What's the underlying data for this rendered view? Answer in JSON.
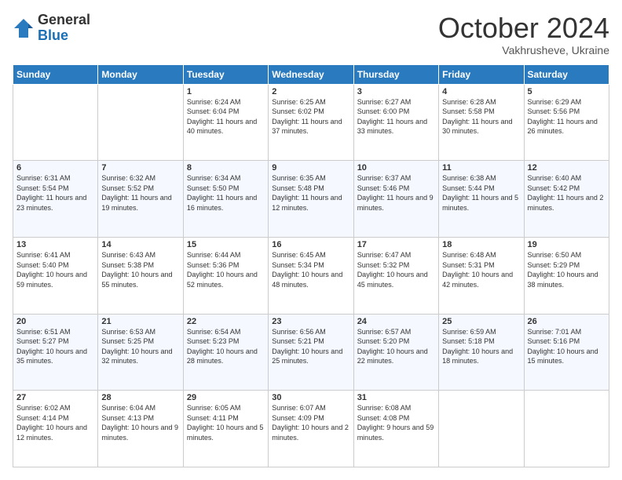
{
  "logo": {
    "general": "General",
    "blue": "Blue"
  },
  "header": {
    "month": "October 2024",
    "location": "Vakhrusheve, Ukraine"
  },
  "weekdays": [
    "Sunday",
    "Monday",
    "Tuesday",
    "Wednesday",
    "Thursday",
    "Friday",
    "Saturday"
  ],
  "weeks": [
    [
      {
        "day": "",
        "info": ""
      },
      {
        "day": "",
        "info": ""
      },
      {
        "day": "1",
        "info": "Sunrise: 6:24 AM\nSunset: 6:04 PM\nDaylight: 11 hours and 40 minutes."
      },
      {
        "day": "2",
        "info": "Sunrise: 6:25 AM\nSunset: 6:02 PM\nDaylight: 11 hours and 37 minutes."
      },
      {
        "day": "3",
        "info": "Sunrise: 6:27 AM\nSunset: 6:00 PM\nDaylight: 11 hours and 33 minutes."
      },
      {
        "day": "4",
        "info": "Sunrise: 6:28 AM\nSunset: 5:58 PM\nDaylight: 11 hours and 30 minutes."
      },
      {
        "day": "5",
        "info": "Sunrise: 6:29 AM\nSunset: 5:56 PM\nDaylight: 11 hours and 26 minutes."
      }
    ],
    [
      {
        "day": "6",
        "info": "Sunrise: 6:31 AM\nSunset: 5:54 PM\nDaylight: 11 hours and 23 minutes."
      },
      {
        "day": "7",
        "info": "Sunrise: 6:32 AM\nSunset: 5:52 PM\nDaylight: 11 hours and 19 minutes."
      },
      {
        "day": "8",
        "info": "Sunrise: 6:34 AM\nSunset: 5:50 PM\nDaylight: 11 hours and 16 minutes."
      },
      {
        "day": "9",
        "info": "Sunrise: 6:35 AM\nSunset: 5:48 PM\nDaylight: 11 hours and 12 minutes."
      },
      {
        "day": "10",
        "info": "Sunrise: 6:37 AM\nSunset: 5:46 PM\nDaylight: 11 hours and 9 minutes."
      },
      {
        "day": "11",
        "info": "Sunrise: 6:38 AM\nSunset: 5:44 PM\nDaylight: 11 hours and 5 minutes."
      },
      {
        "day": "12",
        "info": "Sunrise: 6:40 AM\nSunset: 5:42 PM\nDaylight: 11 hours and 2 minutes."
      }
    ],
    [
      {
        "day": "13",
        "info": "Sunrise: 6:41 AM\nSunset: 5:40 PM\nDaylight: 10 hours and 59 minutes."
      },
      {
        "day": "14",
        "info": "Sunrise: 6:43 AM\nSunset: 5:38 PM\nDaylight: 10 hours and 55 minutes."
      },
      {
        "day": "15",
        "info": "Sunrise: 6:44 AM\nSunset: 5:36 PM\nDaylight: 10 hours and 52 minutes."
      },
      {
        "day": "16",
        "info": "Sunrise: 6:45 AM\nSunset: 5:34 PM\nDaylight: 10 hours and 48 minutes."
      },
      {
        "day": "17",
        "info": "Sunrise: 6:47 AM\nSunset: 5:32 PM\nDaylight: 10 hours and 45 minutes."
      },
      {
        "day": "18",
        "info": "Sunrise: 6:48 AM\nSunset: 5:31 PM\nDaylight: 10 hours and 42 minutes."
      },
      {
        "day": "19",
        "info": "Sunrise: 6:50 AM\nSunset: 5:29 PM\nDaylight: 10 hours and 38 minutes."
      }
    ],
    [
      {
        "day": "20",
        "info": "Sunrise: 6:51 AM\nSunset: 5:27 PM\nDaylight: 10 hours and 35 minutes."
      },
      {
        "day": "21",
        "info": "Sunrise: 6:53 AM\nSunset: 5:25 PM\nDaylight: 10 hours and 32 minutes."
      },
      {
        "day": "22",
        "info": "Sunrise: 6:54 AM\nSunset: 5:23 PM\nDaylight: 10 hours and 28 minutes."
      },
      {
        "day": "23",
        "info": "Sunrise: 6:56 AM\nSunset: 5:21 PM\nDaylight: 10 hours and 25 minutes."
      },
      {
        "day": "24",
        "info": "Sunrise: 6:57 AM\nSunset: 5:20 PM\nDaylight: 10 hours and 22 minutes."
      },
      {
        "day": "25",
        "info": "Sunrise: 6:59 AM\nSunset: 5:18 PM\nDaylight: 10 hours and 18 minutes."
      },
      {
        "day": "26",
        "info": "Sunrise: 7:01 AM\nSunset: 5:16 PM\nDaylight: 10 hours and 15 minutes."
      }
    ],
    [
      {
        "day": "27",
        "info": "Sunrise: 6:02 AM\nSunset: 4:14 PM\nDaylight: 10 hours and 12 minutes."
      },
      {
        "day": "28",
        "info": "Sunrise: 6:04 AM\nSunset: 4:13 PM\nDaylight: 10 hours and 9 minutes."
      },
      {
        "day": "29",
        "info": "Sunrise: 6:05 AM\nSunset: 4:11 PM\nDaylight: 10 hours and 5 minutes."
      },
      {
        "day": "30",
        "info": "Sunrise: 6:07 AM\nSunset: 4:09 PM\nDaylight: 10 hours and 2 minutes."
      },
      {
        "day": "31",
        "info": "Sunrise: 6:08 AM\nSunset: 4:08 PM\nDaylight: 9 hours and 59 minutes."
      },
      {
        "day": "",
        "info": ""
      },
      {
        "day": "",
        "info": ""
      }
    ]
  ]
}
